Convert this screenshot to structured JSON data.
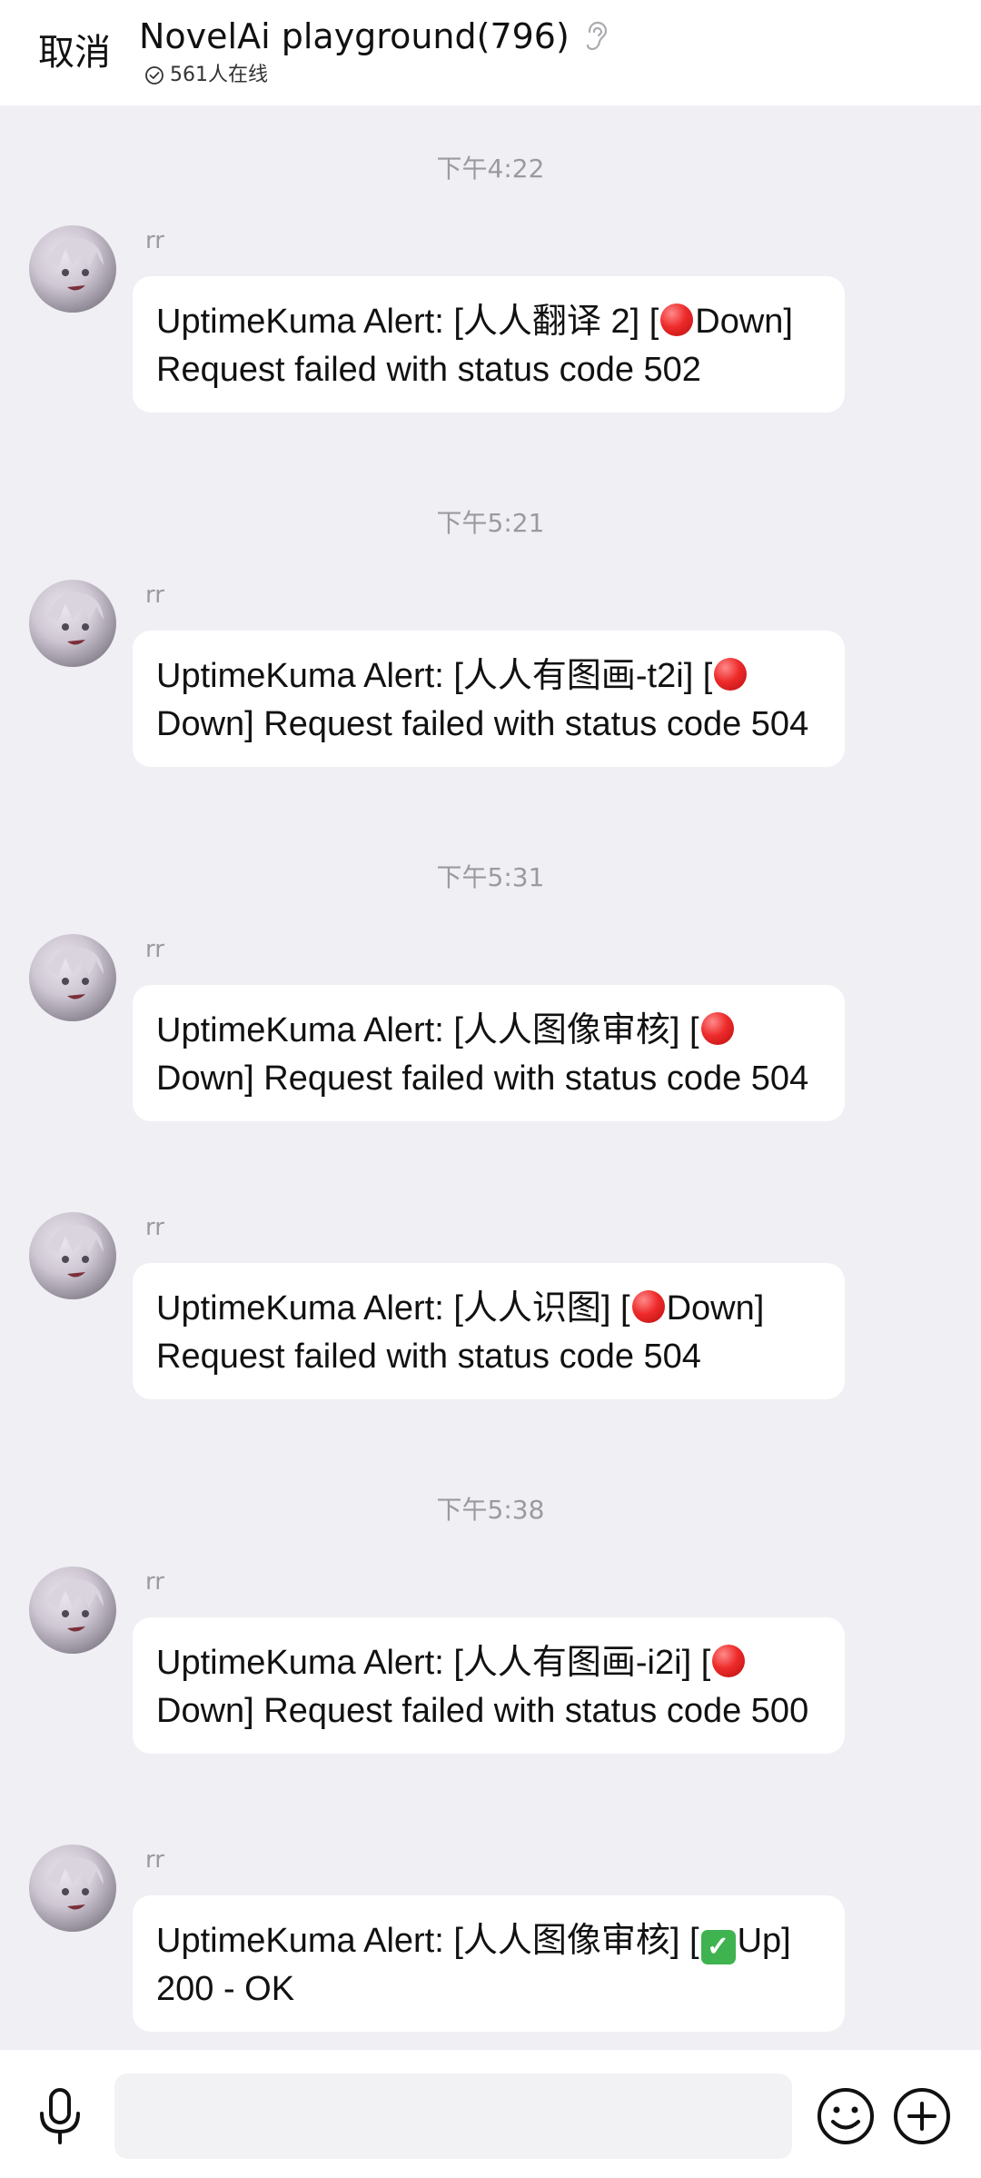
{
  "header": {
    "cancel_label": "取消",
    "title": "NovelAi playground(796)",
    "online_text": "561人在线"
  },
  "messages": [
    {
      "time": "下午4:22",
      "sender": "rr",
      "before": "UptimeKuma Alert: [人人翻译 2] [",
      "status_icon": "red-circle-icon",
      "after": "Down] Request failed with status code 502"
    },
    {
      "time": "下午5:21",
      "sender": "rr",
      "before": "UptimeKuma Alert: [人人有图画-t2i] [",
      "status_icon": "red-circle-icon",
      "after": "Down] Request failed with status code 504"
    },
    {
      "time": "下午5:31",
      "sender": "rr",
      "before": "UptimeKuma Alert: [人人图像审核] [",
      "status_icon": "red-circle-icon",
      "after": "Down] Request failed with status code 504"
    },
    {
      "time": "",
      "sender": "rr",
      "before": "UptimeKuma Alert: [人人识图] [",
      "status_icon": "red-circle-icon",
      "after": "Down] Request failed with status code 504"
    },
    {
      "time": "下午5:38",
      "sender": "rr",
      "before": "UptimeKuma Alert: [人人有图画-i2i] [",
      "status_icon": "red-circle-icon",
      "after": "Down] Request failed with status code 500"
    },
    {
      "time": "",
      "sender": "rr",
      "before": "UptimeKuma Alert: [人人图像审核] [",
      "status_icon": "check-mark-icon",
      "after": "Up] 200 - OK"
    }
  ],
  "colors": {
    "background": "#F0EFF4",
    "bubble": "#FFFFFF",
    "timestamp": "#9A9AA0",
    "status_down": "#EE2B2B",
    "status_up": "#3FB34F"
  },
  "input_bar": {
    "icons": [
      "microphone-icon",
      "emoji-icon",
      "plus-icon"
    ]
  }
}
